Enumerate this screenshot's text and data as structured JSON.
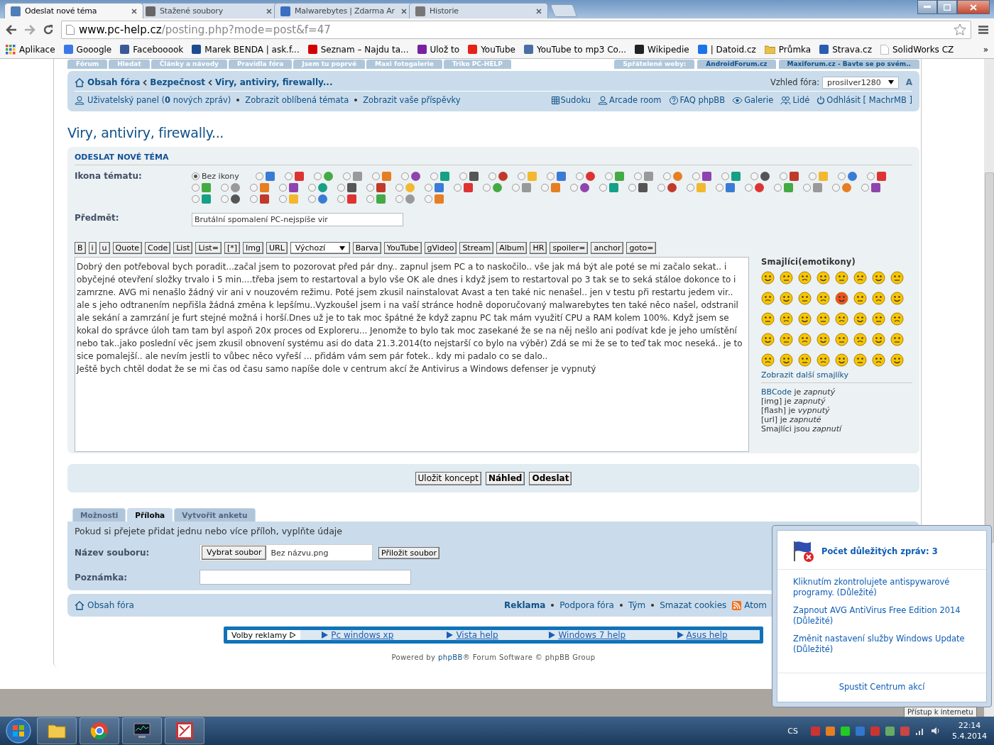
{
  "browser": {
    "tabs": [
      {
        "title": "Odeslat nové téma",
        "selected": true
      },
      {
        "title": "Stažené soubory",
        "selected": false
      },
      {
        "title": "Malwarebytes | Zdarma Ar",
        "selected": false
      },
      {
        "title": "Historie",
        "selected": false
      }
    ],
    "address": {
      "host": "www.pc-help.cz",
      "path": "/posting.php?mode=post&f=47"
    },
    "bookmarks": [
      {
        "label": "Aplikace",
        "kind": "apps"
      },
      {
        "label": "Gooogle",
        "kind": "site",
        "color": "#3b78e7"
      },
      {
        "label": "Facebooook",
        "kind": "site",
        "color": "#3b5998"
      },
      {
        "label": "Marek BENDA | ask.f...",
        "kind": "site",
        "color": "#1d4b8f"
      },
      {
        "label": "Seznam – Najdu ta...",
        "kind": "site",
        "color": "#d40000"
      },
      {
        "label": "Ulož to",
        "kind": "site",
        "color": "#7a1fa2"
      },
      {
        "label": "YouTube",
        "kind": "site",
        "color": "#e62117"
      },
      {
        "label": "YouTube to mp3 Co...",
        "kind": "site",
        "color": "#4a6fa5"
      },
      {
        "label": "Wikipedie",
        "kind": "site",
        "color": "#222222"
      },
      {
        "label": "| Datoid.cz",
        "kind": "site",
        "color": "#1a73e8"
      },
      {
        "label": "Průmka",
        "kind": "folder",
        "color": "#e8c04a"
      },
      {
        "label": "Strava.cz",
        "kind": "site",
        "color": "#2a5db0"
      },
      {
        "label": "SolidWorks CZ",
        "kind": "page",
        "color": "#bbbbbb"
      }
    ],
    "bookmarks_more": "»"
  },
  "forum": {
    "nav_tabs": [
      "Fórum",
      "Hledat",
      "Články a návody",
      "Pravidla fóra",
      "Jsem tu poprvé",
      "Maxi fotogalerie",
      "Triko PC-HELP"
    ],
    "partner_sites": {
      "label": "Spřátelené weby:",
      "links": [
        "AndroidForum.cz",
        "Maxiforum.cz - Bavte se po svém.."
      ]
    },
    "breadcrumbs": [
      "Obsah fóra",
      "Bezpečnost",
      "Viry, antiviry, firewally..."
    ],
    "style_select": {
      "label": "Vzhled fóra:",
      "value": "prosilver1280"
    },
    "font_size_label": "A",
    "user_links": [
      "Uživatelský panel (**0** nových zpráv)",
      "Zobrazit oblíbená témata",
      "Zobrazit vaše příspěvky"
    ],
    "right_links": [
      {
        "label": "Sudoku",
        "kind": "grid"
      },
      {
        "label": "Arcade room",
        "kind": "user"
      },
      {
        "label": "FAQ phpBB",
        "kind": "help"
      },
      {
        "label": "Galerie",
        "kind": "eye"
      },
      {
        "label": "Lidé",
        "kind": "users"
      },
      {
        "label": "Odhlásit [ MachrMB ]",
        "kind": "power"
      }
    ],
    "page_title": "Viry, antiviry, firewally...",
    "form": {
      "heading": "ODESLAT NOVÉ TÉMA",
      "icon_label": "Ikona tématu:",
      "no_icon_label": "Bez ikony",
      "topic_icons": [
        {
          "kind": "none",
          "selected": true
        },
        {
          "kind": "image",
          "selected": false
        },
        {
          "kind": "image",
          "selected": false
        },
        {
          "kind": "image",
          "selected": false
        },
        {
          "kind": "image",
          "selected": false
        },
        {
          "kind": "image",
          "selected": false
        },
        {
          "kind": "image",
          "selected": false
        },
        {
          "kind": "image",
          "selected": false
        },
        {
          "kind": "image",
          "selected": false
        },
        {
          "kind": "image",
          "selected": false
        },
        {
          "kind": "image",
          "selected": false
        },
        {
          "kind": "image",
          "selected": false
        },
        {
          "kind": "image",
          "selected": false
        },
        {
          "kind": "image",
          "selected": false
        },
        {
          "kind": "image",
          "selected": false
        },
        {
          "kind": "image",
          "selected": false
        },
        {
          "kind": "image",
          "selected": false
        },
        {
          "kind": "image",
          "selected": false
        },
        {
          "kind": "image",
          "selected": false
        },
        {
          "kind": "image",
          "selected": false
        },
        {
          "kind": "image",
          "selected": false
        },
        {
          "kind": "image",
          "selected": false
        },
        {
          "kind": "image",
          "selected": false
        },
        {
          "kind": "image",
          "selected": false
        },
        {
          "kind": "image",
          "selected": false
        },
        {
          "kind": "image",
          "selected": false
        },
        {
          "kind": "image",
          "selected": false
        },
        {
          "kind": "image",
          "selected": false
        },
        {
          "kind": "image",
          "selected": false
        },
        {
          "kind": "image",
          "selected": false
        },
        {
          "kind": "image",
          "selected": false
        },
        {
          "kind": "image",
          "selected": false
        },
        {
          "kind": "image",
          "selected": false
        },
        {
          "kind": "image",
          "selected": false
        },
        {
          "kind": "image",
          "selected": false
        },
        {
          "kind": "image",
          "selected": false
        },
        {
          "kind": "image",
          "selected": false
        },
        {
          "kind": "image",
          "selected": false
        },
        {
          "kind": "image",
          "selected": false
        },
        {
          "kind": "image",
          "selected": false
        },
        {
          "kind": "image",
          "selected": false
        },
        {
          "kind": "image",
          "selected": false
        },
        {
          "kind": "image",
          "selected": false
        },
        {
          "kind": "image",
          "selected": false
        },
        {
          "kind": "image",
          "selected": false
        },
        {
          "kind": "image",
          "selected": false
        },
        {
          "kind": "image",
          "selected": false
        },
        {
          "kind": "image",
          "selected": false
        },
        {
          "kind": "image",
          "selected": false
        },
        {
          "kind": "image",
          "selected": false
        },
        {
          "kind": "image",
          "selected": false
        },
        {
          "kind": "image",
          "selected": false
        },
        {
          "kind": "image",
          "selected": false
        },
        {
          "kind": "image",
          "selected": false
        },
        {
          "kind": "image",
          "selected": false
        },
        {
          "kind": "image",
          "selected": false
        }
      ],
      "subject_label": "Předmět:",
      "subject": "Brutální spomalení PC-nejspíše vir",
      "toolbar": [
        {
          "kind": "button",
          "label": "B"
        },
        {
          "kind": "button",
          "label": "i"
        },
        {
          "kind": "button",
          "label": "u"
        },
        {
          "kind": "button",
          "label": "Quote"
        },
        {
          "kind": "button",
          "label": "Code"
        },
        {
          "kind": "button",
          "label": "List"
        },
        {
          "kind": "button",
          "label": "List="
        },
        {
          "kind": "button",
          "label": "[*]"
        },
        {
          "kind": "button",
          "label": "Img"
        },
        {
          "kind": "button",
          "label": "URL"
        },
        {
          "kind": "select",
          "label": "Výchozí"
        },
        {
          "kind": "button",
          "label": "Barva"
        },
        {
          "kind": "button",
          "label": "YouTube"
        },
        {
          "kind": "button",
          "label": "gVideo"
        },
        {
          "kind": "button",
          "label": "Stream"
        },
        {
          "kind": "button",
          "label": "Album"
        },
        {
          "kind": "button",
          "label": "HR"
        },
        {
          "kind": "button",
          "label": "spoiler="
        },
        {
          "kind": "button",
          "label": "anchor"
        },
        {
          "kind": "button",
          "label": "goto="
        }
      ],
      "message": [
        "Dobrý den potřeboval bych poradit...začal jsem to pozorovat před pár dny.. zapnul jsem PC a to naskočilo.. vše jak má být ale poté se mi začalo sekat.. i obyčejné otevření složky trvalo i 5 min....třeba jsem to restartoval a bylo vše OK ale dnes i když jsem to restartoval po 3 tak se to seká stáloe dokonce to i zamrzne. AVG mi nenašlo žádný vir ani v nouzovém režimu. Poté jsem zkusil nainstalovat Avast a ten také nic nenašel.. jen v testu při restartu jedem vir.. ale s jeho odtranením nepřišla žádná změna  k lepšímu..Vyzkoušel jsem i na vaší stránce hodně doporučovaný malwarebytes ten také něco našel, odstranil ale sekání a zamrzání je furt stejné možná i horší.Dnes už je to tak moc špátné že když zapnu PC tak mám využití CPU a RAM kolem 100%. Když jsem se kokal do správce úloh tam tam byl aspoň 20x proces od Exploreru... Jenomže to bylo tak moc zasekané že se na něj nešlo ani podívat kde je jeho umístění nebo tak..jako poslední věc jsem  zkusil obnovení systému asi do data 21.3.2014(to nejstarší co bylo na výběr) Zdá se mi že se to teď tak moc neseká.. je to sice pomalejší.. ale nevím jestli to vůbec něco vyřeší ... přidám vám sem pár fotek.. kdy mi padalo co se dalo..",
        "Ještě bych chtěl dodat že se mi čas od času samo napíše dole v centrum akcí že Antivirus a Windows defenser je vypnutý"
      ],
      "smilies": {
        "title": "Smajlíci(emotikony)",
        "more_link": "Zobrazit další smajlíky"
      },
      "status": [
        {
          "subject": "BBCode",
          "link": true,
          "verb": "je",
          "state": "zapnutý"
        },
        {
          "subject": "[img]",
          "link": false,
          "verb": "je",
          "state": "zapnutý"
        },
        {
          "subject": "[flash]",
          "link": false,
          "verb": "je",
          "state": "vypnutý"
        },
        {
          "subject": "[url]",
          "link": false,
          "verb": "je",
          "state": "zapnuté"
        },
        {
          "subject": "Smajlíci",
          "link": false,
          "verb": "jsou",
          "state": "zapnutí"
        }
      ],
      "buttons": [
        {
          "label": "Uložit koncept",
          "bold": false
        },
        {
          "label": "Náhled",
          "bold": true
        },
        {
          "label": "Odeslat",
          "bold": true
        }
      ]
    },
    "attachment_tabs": [
      {
        "label": "Možnosti",
        "selected": false
      },
      {
        "label": "Příloha",
        "selected": true
      },
      {
        "label": "Vytvořit anketu",
        "selected": false
      }
    ],
    "attachment": {
      "intro": "Pokud si přejete přidat jednu nebo více příloh, vyplňte údaje",
      "file_label": "Název souboru:",
      "choose_button": "Vybrat soubor",
      "file_name": "Bez názvu.png",
      "attach_button": "Přiložit soubor",
      "comment_label": "Poznámka:"
    },
    "footer": {
      "home": "Obsah fóra",
      "links": [
        {
          "label": "Reklama",
          "bold": true
        },
        {
          "label": "Podpora fóra",
          "bold": false
        },
        {
          "label": "Tým",
          "bold": false
        },
        {
          "label": "Smazat cookies",
          "bold": false
        }
      ],
      "feed": "Atom"
    },
    "ad_bar": {
      "label": "Volby reklamy",
      "links": [
        "Pc windows xp",
        "Vista help",
        "Windows 7 help",
        "Asus help"
      ]
    },
    "powered": {
      "before": "Powered by ",
      "link": "phpBB",
      "after": "® Forum Software © phpBB Group"
    }
  },
  "popup": {
    "title": "Počet důležitých zpráv: 3",
    "messages": [
      "Kliknutím zkontrolujete antispywarové programy. (Důležité)",
      "Zapnout AVG AntiVirus Free Edition 2014 (Důležité)",
      "Změnit nastavení služby Windows Update (Důležité)"
    ],
    "action": "Spustit Centrum akcí"
  },
  "tooltip": "Přístup k internetu",
  "taskbar": {
    "language": "CS",
    "time": "22:14",
    "date": "5.4.2014"
  }
}
